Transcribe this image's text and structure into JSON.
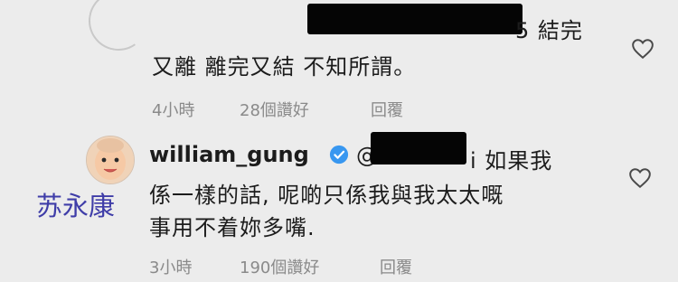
{
  "comment1": {
    "text_line1_suffix": "5 結完",
    "text_line2": "又離 離完又結 不知所謂。",
    "time": "4小時",
    "likes": "28個讚好",
    "reply": "回覆"
  },
  "comment2": {
    "username": "william_gung",
    "mention_prefix": "@",
    "text_line1_suffix": "i 如果我",
    "text_line2": "係一樣的話, 呢啲只係我與我太太嘅",
    "text_line3": "事用不着妳多嘴.",
    "time": "3小時",
    "likes": "190個讚好",
    "reply": "回覆"
  },
  "caption": "苏永康",
  "icons": {
    "like": "heart-outline-icon",
    "verified": "verified-badge-icon"
  },
  "colors": {
    "verified": "#3897f0",
    "caption": "#3f3da8"
  }
}
